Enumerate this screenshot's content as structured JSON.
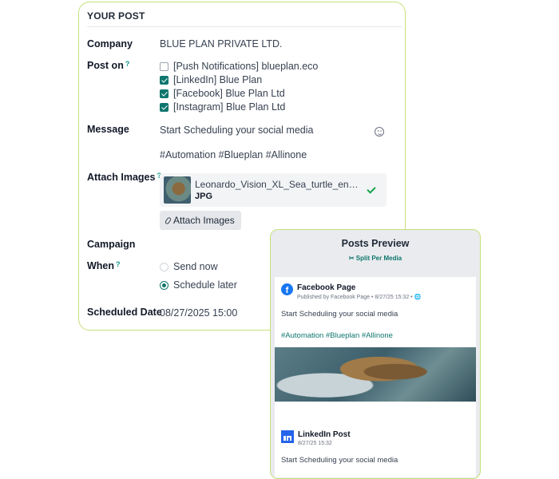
{
  "form": {
    "section_title": "YOUR POST",
    "company": {
      "label": "Company",
      "value": "BLUE PLAN PRIVATE LTD."
    },
    "post_on": {
      "label": "Post on",
      "help": "?",
      "options": [
        {
          "label": "[Push Notifications] blueplan.eco",
          "checked": false
        },
        {
          "label": "[LinkedIn] Blue Plan",
          "checked": true
        },
        {
          "label": "[Facebook] Blue Plan Ltd",
          "checked": true
        },
        {
          "label": "[Instagram] Blue Plan Ltd",
          "checked": true
        }
      ]
    },
    "message": {
      "label": "Message",
      "line1": "Start Scheduling your social media",
      "line2": "#Automation #Blueplan #Allinone",
      "icon": "emoji-add-icon"
    },
    "attach_images": {
      "label": "Attach Images",
      "help": "?",
      "file_name": "Leonardo_Vision_XL_Sea_turtle_entangled_in_plastic.jpg",
      "file_type": "JPG",
      "button_label": "Attach Images"
    },
    "campaign": {
      "label": "Campaign",
      "value": ""
    },
    "when": {
      "label": "When",
      "help": "?",
      "options": [
        {
          "label": "Send now",
          "selected": false
        },
        {
          "label": "Schedule later",
          "selected": true
        }
      ]
    },
    "scheduled_date": {
      "label": "Scheduled Date",
      "value": "08/27/2025 15:00"
    }
  },
  "preview": {
    "title": "Posts Preview",
    "split_label": "✂ Split Per Media",
    "posts": [
      {
        "name": "Facebook Page",
        "meta": "Published by Facebook Page • 8/27/25 15:32 • 🌐",
        "text": "Start Scheduling your social media",
        "tags": "#Automation #Blueplan #Allinone"
      },
      {
        "name": "LinkedIn Post",
        "meta": "8/27/25 15:32",
        "text": "Start Scheduling your social media"
      }
    ]
  },
  "colors": {
    "accent": "#0f766e",
    "card_border": "#c5e17a",
    "facebook": "#1877f2",
    "linkedin": "#2563eb"
  }
}
